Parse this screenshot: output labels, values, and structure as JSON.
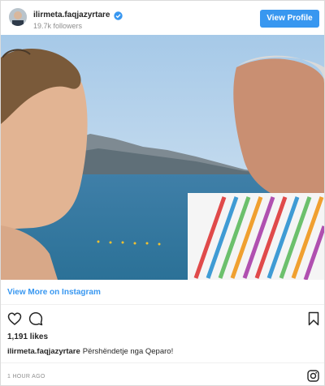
{
  "header": {
    "username": "ilirmeta.faqjazyrtare",
    "followers": "19.7k followers",
    "view_profile_label": "View Profile",
    "verified_icon": "verified-badge-icon"
  },
  "post": {
    "photo_description_icon": "photo",
    "view_more_label": "View More on Instagram",
    "likes": "1,191 likes",
    "caption_user": "ilirmeta.faqjazyrtare",
    "caption_text": "Përshëndetje nga Qeparo!",
    "timestamp": "1 HOUR AGO"
  },
  "icons": {
    "like": "heart-icon",
    "comment": "comment-icon",
    "save": "bookmark-icon",
    "brand": "instagram-icon"
  },
  "colors": {
    "accent": "#3897f0",
    "text": "#262626",
    "muted": "#8e8e8e"
  }
}
